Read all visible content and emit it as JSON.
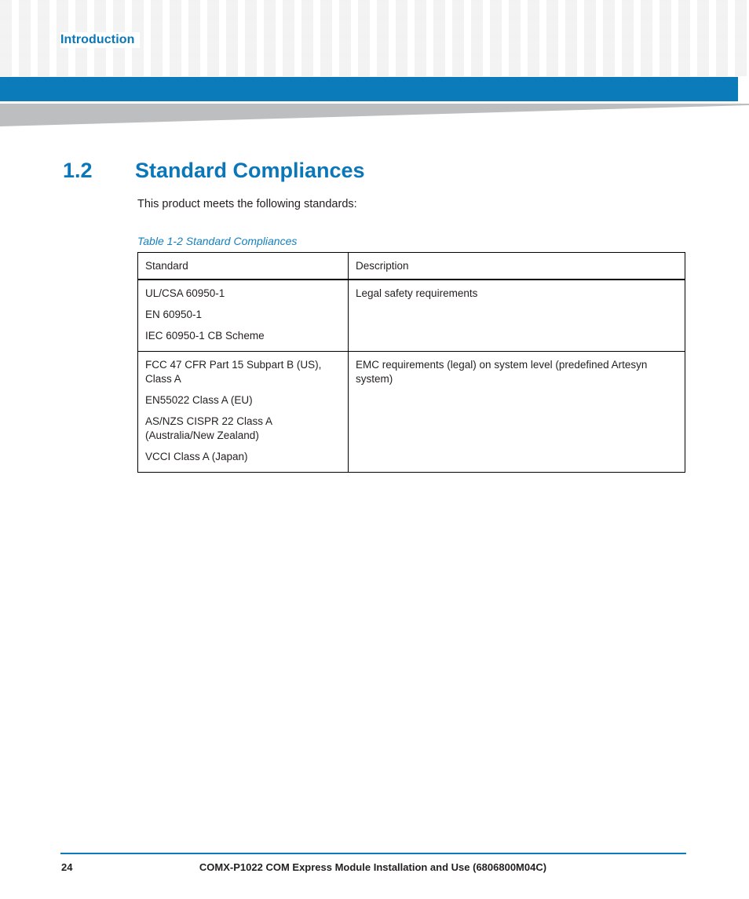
{
  "header": {
    "chapter_title": "Introduction",
    "accent_color": "#0b7bba"
  },
  "section": {
    "number": "1.2",
    "title": "Standard Compliances",
    "intro": "This product meets the following standards:"
  },
  "table": {
    "caption": "Table 1-2 Standard Compliances",
    "columns": [
      "Standard",
      "Description"
    ],
    "rows": [
      {
        "standard": [
          "UL/CSA 60950-1",
          "EN 60950-1",
          "IEC 60950-1 CB Scheme"
        ],
        "description": [
          "Legal safety requirements"
        ]
      },
      {
        "standard": [
          "FCC 47 CFR Part 15 Subpart B (US), Class A",
          "EN55022 Class A (EU)",
          "AS/NZS CISPR 22 Class A (Australia/New Zealand)",
          "VCCI Class A (Japan)"
        ],
        "description": [
          "EMC requirements (legal) on system level (predefined Artesyn system)"
        ]
      }
    ]
  },
  "footer": {
    "page_number": "24",
    "document_title": "COMX-P1022 COM Express Module Installation and Use (6806800M04C)"
  }
}
